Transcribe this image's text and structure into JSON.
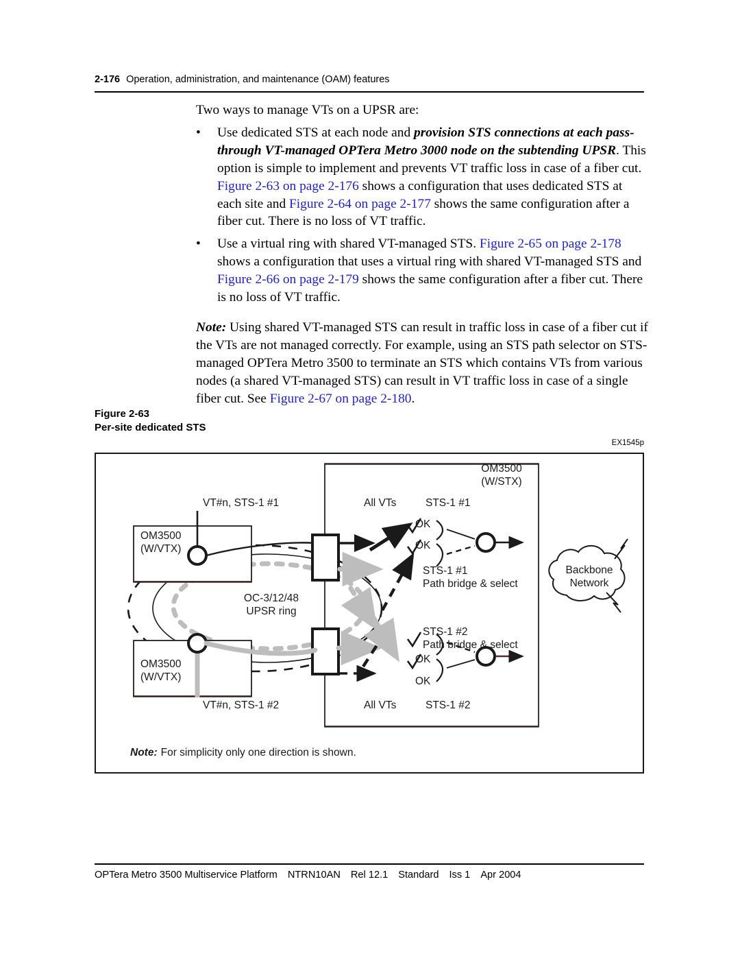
{
  "header": {
    "folio": "2-176",
    "chapter_title": "Operation, administration, and maintenance (OAM) features"
  },
  "body": {
    "intro": "Two ways to manage VTs on a UPSR are:",
    "bullet_mark": "•",
    "bullet1": {
      "p1": "Use dedicated STS at each node and ",
      "emph1": "provision STS connections at each pass-through VT-managed OPTera Metro 3000 node on the subtending UPSR",
      "p2": ". This option is simple to implement and prevents VT traffic loss in case of a fiber cut. ",
      "xref1": "Figure 2-63 on page 2-176",
      "p3": " shows a configuration that uses dedicated STS at each site and ",
      "xref2": "Figure 2-64 on page 2-177",
      "p4": " shows the same configuration after a fiber cut. There is no loss of VT traffic."
    },
    "bullet2": {
      "p1": "Use a virtual ring with shared VT-managed STS. ",
      "xref1": "Figure 2-65 on page 2-178",
      "p2": " shows a configuration that uses a virtual ring with shared VT-managed STS and ",
      "xref2": "Figure 2-66 on page 2-179",
      "p3": " shows the same configuration after a fiber cut. There is no loss of VT traffic."
    },
    "note": {
      "label": "Note:",
      "p1": " Using shared VT-managed STS can result in traffic loss in case of a fiber cut if the VTs are not managed correctly. For example, using an STS path selector on STS-managed OPTera Metro 3500 to terminate an STS which contains VTs from various nodes (a shared VT-managed STS) can result in VT traffic loss in case of a single fiber cut. See ",
      "xref1": "Figure 2-67 on page 2-180",
      "p2": "."
    }
  },
  "figure": {
    "number": "Figure 2-63",
    "title": "Per-site dedicated STS",
    "id_tag": "EX1545p",
    "labels": {
      "stx_node_line1": "OM3500",
      "stx_node_line2": "(W/STX)",
      "vtx_top_line1": "OM3500",
      "vtx_top_line2": "(W/VTX)",
      "vtx_bottom_line1": "OM3500",
      "vtx_bottom_line2": "(W/VTX)",
      "tributary_top": "VT#n, STS-1 #1",
      "tributary_bottom": "VT#n, STS-1 #2",
      "ring_line1": "OC-3/12/48",
      "ring_line2": "UPSR ring",
      "all_vts_top": "All VTs",
      "all_vts_bottom": "All VTs",
      "sts_top_head": "STS-1 #1",
      "sts_top_foot": "STS-1 #1",
      "sts_top_foot2": "Path bridge & select",
      "sts_bottom_head": "STS-1 #2",
      "sts_bottom_head2": "Path bridge & select",
      "sts_bottom_foot": "STS-1 #2",
      "ok_top_1": "OK",
      "ok_top_2": "OK",
      "ok_bottom_1": "OK",
      "ok_bottom_2": "OK",
      "cloud_line1": "Backbone",
      "cloud_line2": "Network"
    },
    "note_label": "Note:",
    "note_text": "For simplicity only one direction is shown."
  },
  "footer": {
    "product": "OPTera Metro 3500 Multiservice Platform",
    "pec": "NTRN10AN",
    "release": "Rel 12.1",
    "status": "Standard",
    "issue": "Iss 1",
    "date": "Apr 2004"
  },
  "colors": {
    "xref_blue": "#2222cc",
    "line_black": "#1a1a1a",
    "protect_gray": "#bdbdbd",
    "box_maroon": "#5a2b2b"
  }
}
